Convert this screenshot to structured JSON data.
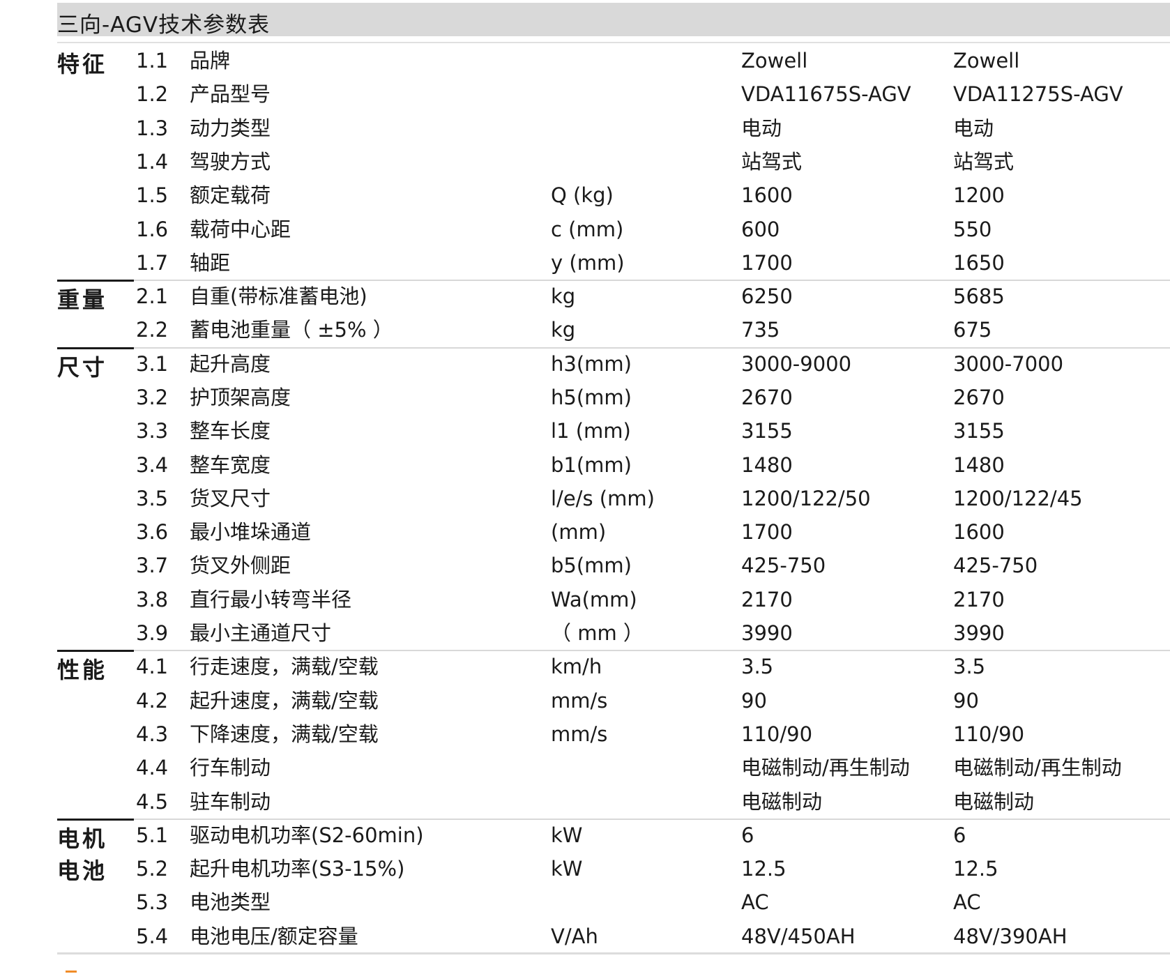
{
  "title": "三向-AGV技术参数表",
  "sections": [
    {
      "category": "特征",
      "rows": [
        {
          "no": "1.1",
          "name": "品牌",
          "unit": "",
          "v1": "Zowell",
          "v2": "Zowell"
        },
        {
          "no": "1.2",
          "name": "产品型号",
          "unit": "",
          "v1": "VDA11675S-AGV",
          "v2": "VDA11275S-AGV"
        },
        {
          "no": "1.3",
          "name": "动力类型",
          "unit": "",
          "v1": "电动",
          "v2": "电动"
        },
        {
          "no": "1.4",
          "name": "驾驶方式",
          "unit": "",
          "v1": "站驾式",
          "v2": "站驾式"
        },
        {
          "no": "1.5",
          "name": "额定载荷",
          "unit": "Q (kg)",
          "v1": "1600",
          "v2": "1200"
        },
        {
          "no": "1.6",
          "name": "载荷中心距",
          "unit": "c (mm)",
          "v1": "600",
          "v2": "550"
        },
        {
          "no": "1.7",
          "name": "轴距",
          "unit": "y (mm)",
          "v1": "1700",
          "v2": "1650"
        }
      ]
    },
    {
      "category": "重量",
      "rows": [
        {
          "no": "2.1",
          "name": "自重(带标准蓄电池)",
          "unit": "kg",
          "v1": "6250",
          "v2": "5685"
        },
        {
          "no": "2.2",
          "name": "蓄电池重量（ ±5% ）",
          "unit": "kg",
          "v1": "735",
          "v2": "675"
        }
      ]
    },
    {
      "category": "尺寸",
      "rows": [
        {
          "no": "3.1",
          "name": "起升高度",
          "unit": "h3(mm)",
          "v1": "3000-9000",
          "v2": "3000-7000"
        },
        {
          "no": "3.2",
          "name": "护顶架高度",
          "unit": "h5(mm)",
          "v1": "2670",
          "v2": "2670"
        },
        {
          "no": "3.3",
          "name": "整车长度",
          "unit": "l1 (mm)",
          "v1": "3155",
          "v2": "3155"
        },
        {
          "no": "3.4",
          "name": "整车宽度",
          "unit": "b1(mm)",
          "v1": "1480",
          "v2": "1480"
        },
        {
          "no": "3.5",
          "name": "货叉尺寸",
          "unit": "l/e/s (mm)",
          "v1": "1200/122/50",
          "v2": "1200/122/45"
        },
        {
          "no": "3.6",
          "name": "最小堆垛通道",
          "unit": "(mm)",
          "v1": "1700",
          "v2": "1600"
        },
        {
          "no": "3.7",
          "name": "货叉外侧距",
          "unit": "b5(mm)",
          "v1": "425-750",
          "v2": "425-750"
        },
        {
          "no": "3.8",
          "name": "直行最小转弯半径",
          "unit": "Wa(mm)",
          "v1": "2170",
          "v2": "2170"
        },
        {
          "no": "3.9",
          "name": "最小主通道尺寸",
          "unit": "（ mm ）",
          "v1": "3990",
          "v2": "3990"
        }
      ]
    },
    {
      "category": "性能",
      "rows": [
        {
          "no": "4.1",
          "name": "行走速度，满载/空载",
          "unit": "km/h",
          "v1": "3.5",
          "v2": "3.5"
        },
        {
          "no": "4.2",
          "name": "起升速度，满载/空载",
          "unit": "mm/s",
          "v1": "90",
          "v2": "90"
        },
        {
          "no": "4.3",
          "name": "下降速度，满载/空载",
          "unit": "mm/s",
          "v1": "110/90",
          "v2": "110/90"
        },
        {
          "no": "4.4",
          "name": "行车制动",
          "unit": "",
          "v1": "电磁制动/再生制动",
          "v2": "电磁制动/再生制动"
        },
        {
          "no": "4.5",
          "name": "驻车制动",
          "unit": "",
          "v1": "电磁制动",
          "v2": "电磁制动"
        }
      ]
    },
    {
      "category": "电机\n电池",
      "rows": [
        {
          "no": "5.1",
          "name": "驱动电机功率(S2-60min)",
          "unit": "kW",
          "v1": "6",
          "v2": "6"
        },
        {
          "no": "5.2",
          "name": "起升电机功率(S3-15%)",
          "unit": "kW",
          "v1": "12.5",
          "v2": "12.5"
        },
        {
          "no": "5.3",
          "name": "电池类型",
          "unit": "",
          "v1": "AC",
          "v2": "AC"
        },
        {
          "no": "5.4",
          "name": "电池电压/额定容量",
          "unit": "V/Ah",
          "v1": "48V/450AH",
          "v2": "48V/390AH"
        }
      ]
    }
  ]
}
